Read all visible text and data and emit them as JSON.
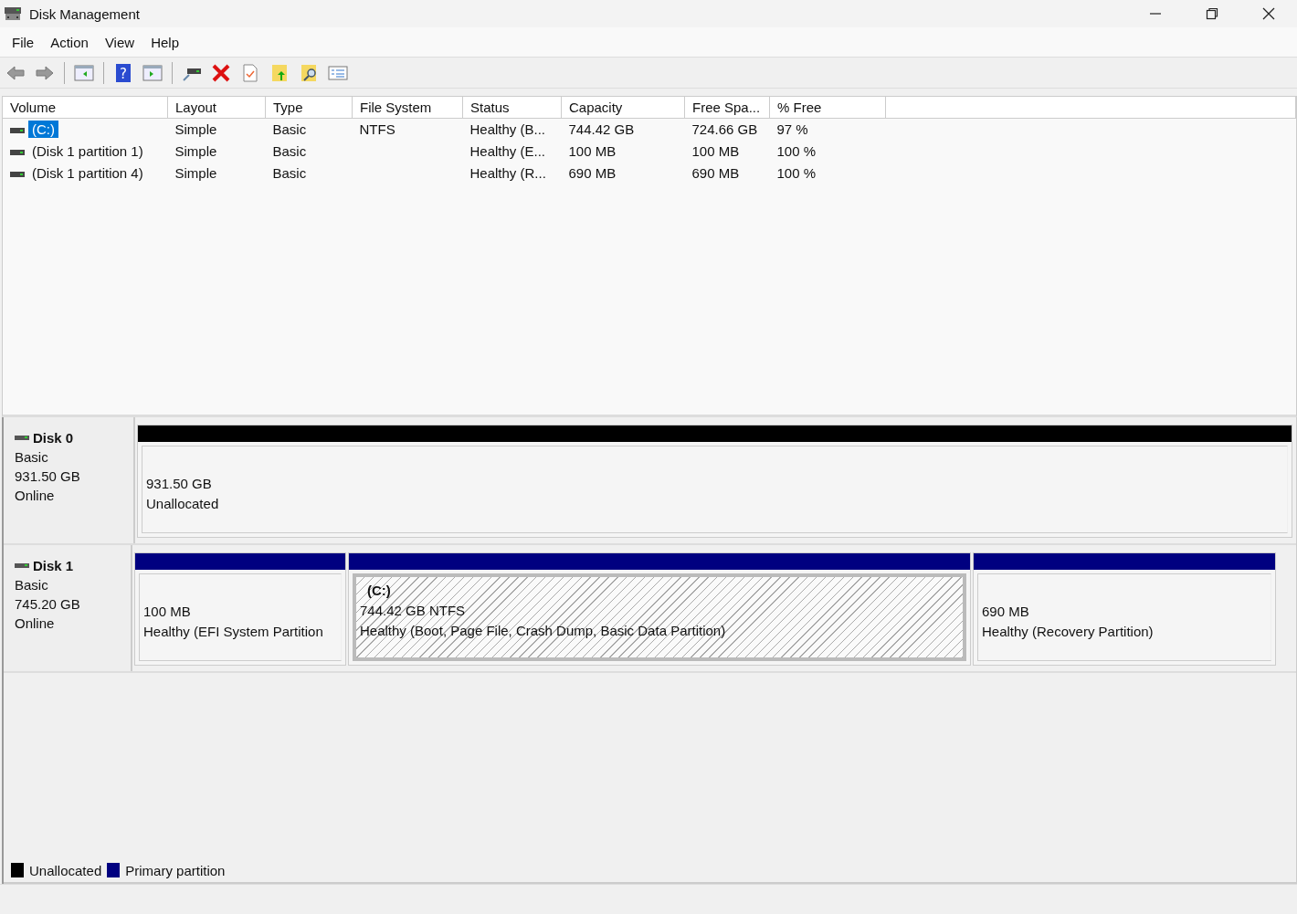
{
  "window": {
    "title": "Disk Management"
  },
  "menu": [
    "File",
    "Action",
    "View",
    "Help"
  ],
  "toolbar": {
    "help_glyph": "?"
  },
  "table": {
    "columns": [
      "Volume",
      "Layout",
      "Type",
      "File System",
      "Status",
      "Capacity",
      "Free Spa...",
      "% Free"
    ],
    "rows": [
      {
        "cells": [
          "(C:)",
          "Simple",
          "Basic",
          "NTFS",
          "Healthy (B...",
          "744.42 GB",
          "724.66 GB",
          "97 %"
        ],
        "selected": true
      },
      {
        "cells": [
          "(Disk 1 partition 1)",
          "Simple",
          "Basic",
          "",
          "Healthy (E...",
          "100 MB",
          "100 MB",
          "100 %"
        ],
        "selected": false
      },
      {
        "cells": [
          "(Disk 1 partition 4)",
          "Simple",
          "Basic",
          "",
          "Healthy (R...",
          "690 MB",
          "690 MB",
          "100 %"
        ],
        "selected": false
      }
    ]
  },
  "disks": [
    {
      "name": "Disk 0",
      "type": "Basic",
      "size": "931.50 GB",
      "status": "Online",
      "partitions": [
        {
          "kind": "unallocated",
          "size": "931.50 GB",
          "status": "Unallocated",
          "selected": false
        }
      ]
    },
    {
      "name": "Disk 1",
      "type": "Basic",
      "size": "745.20 GB",
      "status": "Online",
      "partitions": [
        {
          "kind": "primary",
          "size": "100 MB",
          "status": "Healthy (EFI System Partition",
          "selected": false
        },
        {
          "kind": "primary",
          "label": "(C:)",
          "size": "744.42 GB NTFS",
          "status": "Healthy (Boot, Page File, Crash Dump, Basic Data Partition)",
          "selected": true
        },
        {
          "kind": "primary",
          "size": "690 MB",
          "status": "Healthy (Recovery Partition)",
          "selected": false
        }
      ]
    }
  ],
  "legend": [
    {
      "label": "Unallocated",
      "color": "#000000"
    },
    {
      "label": "Primary partition",
      "color": "#000080"
    }
  ]
}
